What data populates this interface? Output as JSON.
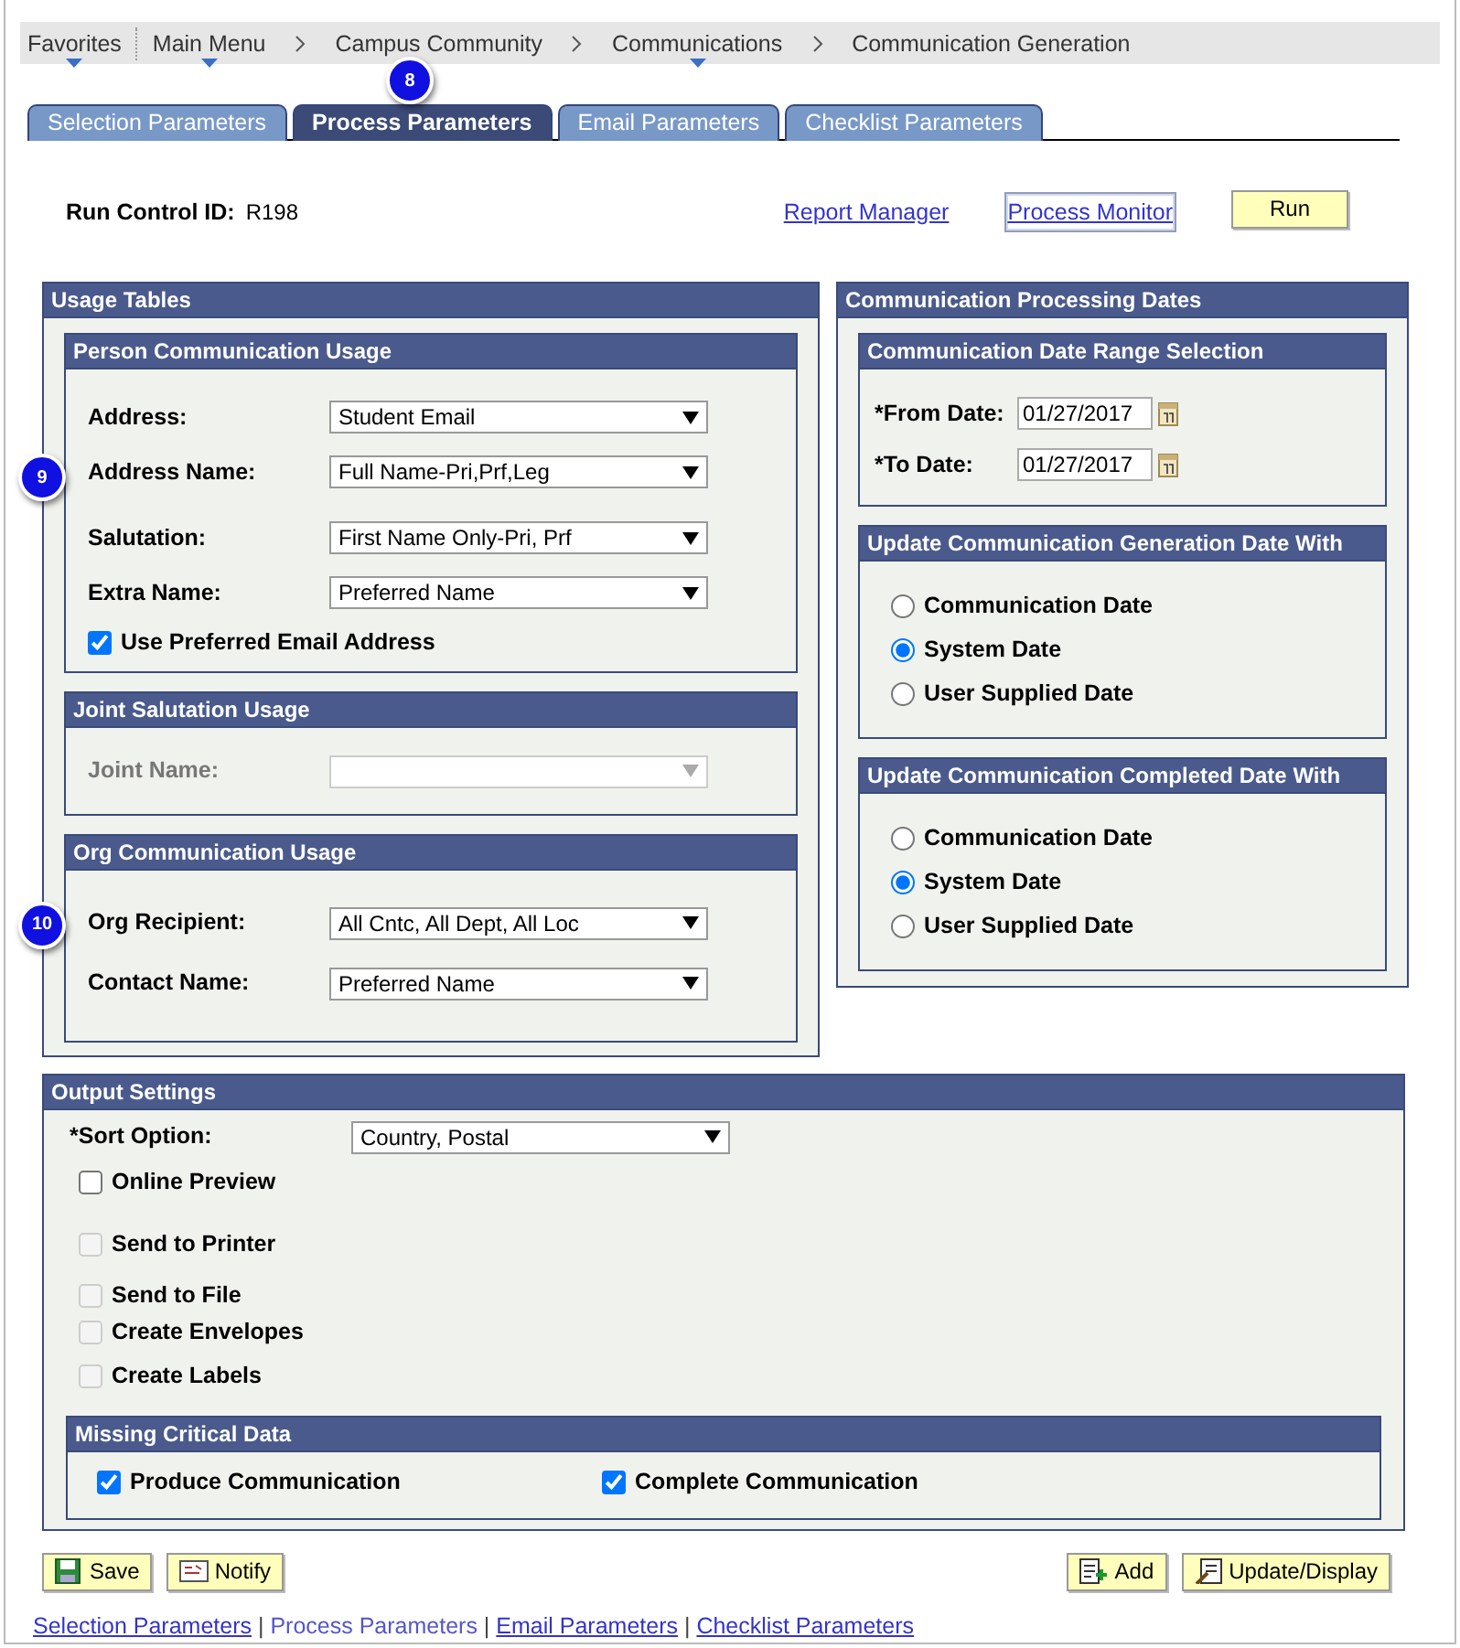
{
  "breadcrumb": [
    {
      "label": "Favorites",
      "dropdown": true
    },
    {
      "label": "Main Menu",
      "dropdown": true
    },
    {
      "label": "Campus Community",
      "dropdown": false
    },
    {
      "label": "Communications",
      "dropdown": true
    },
    {
      "label": "Communication Generation",
      "dropdown": false
    }
  ],
  "tabs_callout": "8",
  "tabs": [
    {
      "label": "Selection Parameters",
      "selected": false
    },
    {
      "label": "Process Parameters",
      "selected": true
    },
    {
      "label": "Email Parameters",
      "selected": false
    },
    {
      "label": "Checklist Parameters",
      "selected": false
    }
  ],
  "run_control": {
    "label": "Run Control ID:",
    "value": "R198"
  },
  "header_links": [
    {
      "label": "Report Manager",
      "focused": false
    },
    {
      "label": "Process Monitor",
      "focused": true
    }
  ],
  "run_button": "Run",
  "usage_tables": {
    "title": "Usage Tables",
    "sections": [
      {
        "title": "Person Communication Usage",
        "callout": "9",
        "fields": [
          {
            "label": "Address:",
            "value": "Student Email",
            "disabled": false
          },
          {
            "label": "Address Name:",
            "value": "Full Name-Pri,Prf,Leg",
            "disabled": false
          },
          {
            "label": "Salutation:",
            "value": "First Name Only-Pri, Prf",
            "disabled": false
          },
          {
            "label": "Extra Name:",
            "value": "Preferred Name",
            "disabled": false
          }
        ],
        "checkboxes": [
          {
            "label": "Use Preferred Email Address",
            "checked": true
          }
        ]
      },
      {
        "title": "Joint Salutation Usage",
        "fields": [
          {
            "label": "Joint Name:",
            "disabled": true
          }
        ]
      },
      {
        "title": "Org Communication Usage",
        "callout": "10",
        "fields": [
          {
            "label": "Org Recipient:",
            "value": "All Cntc, All Dept, All Loc",
            "disabled": false
          },
          {
            "label": "Contact Name:",
            "value": "Preferred Name",
            "disabled": false
          }
        ]
      }
    ]
  },
  "processing_dates": {
    "title": "Communication Processing Dates",
    "sections": [
      {
        "title": "Communication Date Range Selection",
        "kind": "dates",
        "fields": [
          {
            "label": "*From Date:",
            "value": "01/27/2017"
          },
          {
            "label": "*To Date:",
            "value": "01/27/2017"
          }
        ]
      },
      {
        "title": "Update Communication Generation Date With",
        "kind": "radios",
        "options": [
          {
            "label": "Communication Date",
            "selected": false
          },
          {
            "label": "System Date",
            "selected": true
          },
          {
            "label": "User Supplied Date",
            "selected": false
          }
        ]
      },
      {
        "title": "Update Communication Completed Date With",
        "kind": "radios",
        "options": [
          {
            "label": "Communication Date",
            "selected": false
          },
          {
            "label": "System Date",
            "selected": true
          },
          {
            "label": "User Supplied Date",
            "selected": false
          }
        ]
      }
    ]
  },
  "output_settings": {
    "title": "Output Settings",
    "sort_option": {
      "label": "*Sort Option:",
      "value": "Country, Postal"
    },
    "checkboxes": [
      {
        "label": "Online Preview",
        "checked": false,
        "disabled": false
      },
      {
        "label": "Send to Printer",
        "checked": false,
        "disabled": true
      },
      {
        "label": "Send to File",
        "checked": false,
        "disabled": true
      },
      {
        "label": "Create Envelopes",
        "checked": false,
        "disabled": true
      },
      {
        "label": "Create Labels",
        "checked": false,
        "disabled": true
      }
    ],
    "missing_data": {
      "title": "Missing Critical Data",
      "checkboxes": [
        {
          "label": "Produce Communication",
          "checked": true
        },
        {
          "label": "Complete Communication",
          "checked": true
        }
      ]
    }
  },
  "buttons_left": [
    {
      "label": "Save",
      "kind": "save"
    },
    {
      "label": "Notify",
      "kind": "notify"
    }
  ],
  "buttons_right": [
    {
      "label": "Add",
      "kind": "add"
    },
    {
      "label": "Update/Display",
      "kind": "update"
    }
  ],
  "footer_links": [
    {
      "label": "Selection Parameters",
      "current": false
    },
    {
      "label": "Process Parameters",
      "current": true
    },
    {
      "label": "Email Parameters",
      "current": false
    },
    {
      "label": "Checklist Parameters",
      "current": false
    }
  ],
  "footer_separator": "|"
}
